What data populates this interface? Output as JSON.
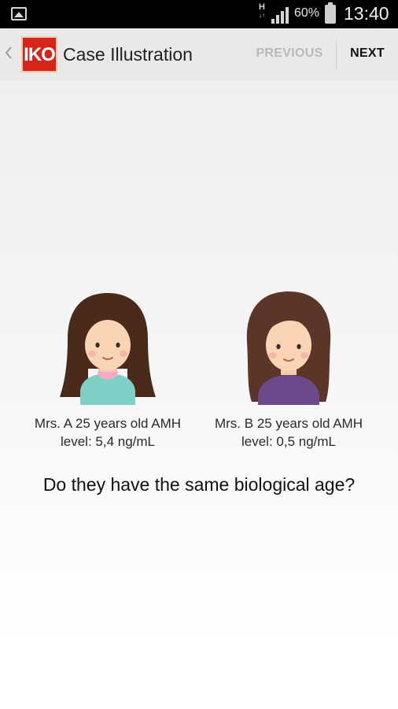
{
  "status_bar": {
    "network_type": "H",
    "network_sub": "↓↑",
    "battery_percent": "60%",
    "time": "13:40",
    "icons": [
      "gallery-icon",
      "signal-icon",
      "battery-icon"
    ]
  },
  "action_bar": {
    "logo_text": "IKO",
    "title": "Case Illustration",
    "previous_label": "PREVIOUS",
    "next_label": "NEXT",
    "logo_color": "#d7241a"
  },
  "case": {
    "patient_a": "Mrs. A 25 years old AMH level: 5,4 ng/mL",
    "patient_b": "Mrs. B 25 years old AMH level: 0,5 ng/mL",
    "question": "Do they have the same biological age?"
  }
}
